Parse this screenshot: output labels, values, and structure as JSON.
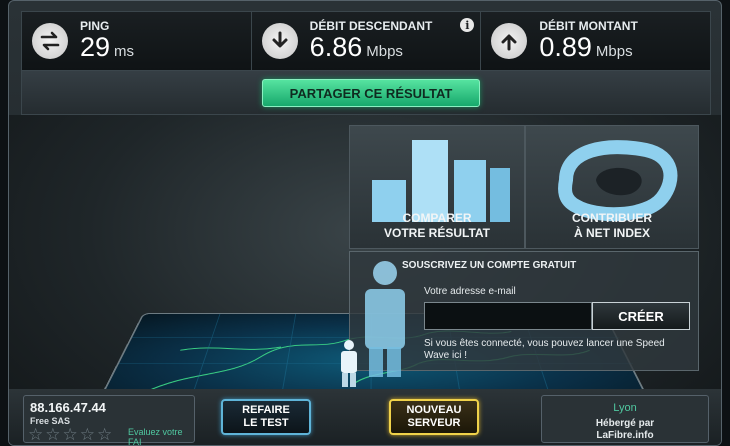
{
  "metrics": {
    "ping": {
      "label": "PING",
      "value": "29",
      "unit": "ms",
      "icon": "ping-arrows-icon"
    },
    "download": {
      "label": "DÉBIT DESCENDANT",
      "value": "6.86",
      "unit": "Mbps",
      "icon": "download-arrow-icon",
      "info": "i"
    },
    "upload": {
      "label": "DÉBIT MONTANT",
      "value": "0.89",
      "unit": "Mbps",
      "icon": "upload-arrow-icon"
    }
  },
  "share": {
    "label": "PARTAGER CE RÉSULTAT"
  },
  "panels": {
    "compare": {
      "line1": "COMPARER",
      "line2": "VOTRE RÉSULTAT",
      "icon": "bar-chart-icon"
    },
    "contribute": {
      "line1": "CONTRIBUER",
      "line2": "À NET INDEX",
      "icon": "net-index-ring-icon"
    }
  },
  "signup": {
    "title": "SOUSCRIVEZ UN COMPTE GRATUIT",
    "email_label": "Votre adresse e-mail",
    "email_value": "",
    "create_label": "CRÉER",
    "note": "Si vous êtes connecté, vous pouvez lancer une Speed Wave ici !"
  },
  "bottom": {
    "ip": "88.166.47.44",
    "isp": "Free SAS",
    "rating_text_1": "Evaluez votre",
    "rating_text_2": "FAI",
    "rating": 0,
    "retest_1": "REFAIRE",
    "retest_2": "LE TEST",
    "server_1": "NOUVEAU",
    "server_2": "SERVEUR",
    "city": "Lyon",
    "hosted_1": "Hébergé par",
    "hosted_2": "LaFibre.info"
  },
  "colors": {
    "accent_green": "#17a86c",
    "server_gold": "#f0d24a",
    "retest_blue": "#5fb4d8",
    "map_line": "#3fe08a"
  }
}
